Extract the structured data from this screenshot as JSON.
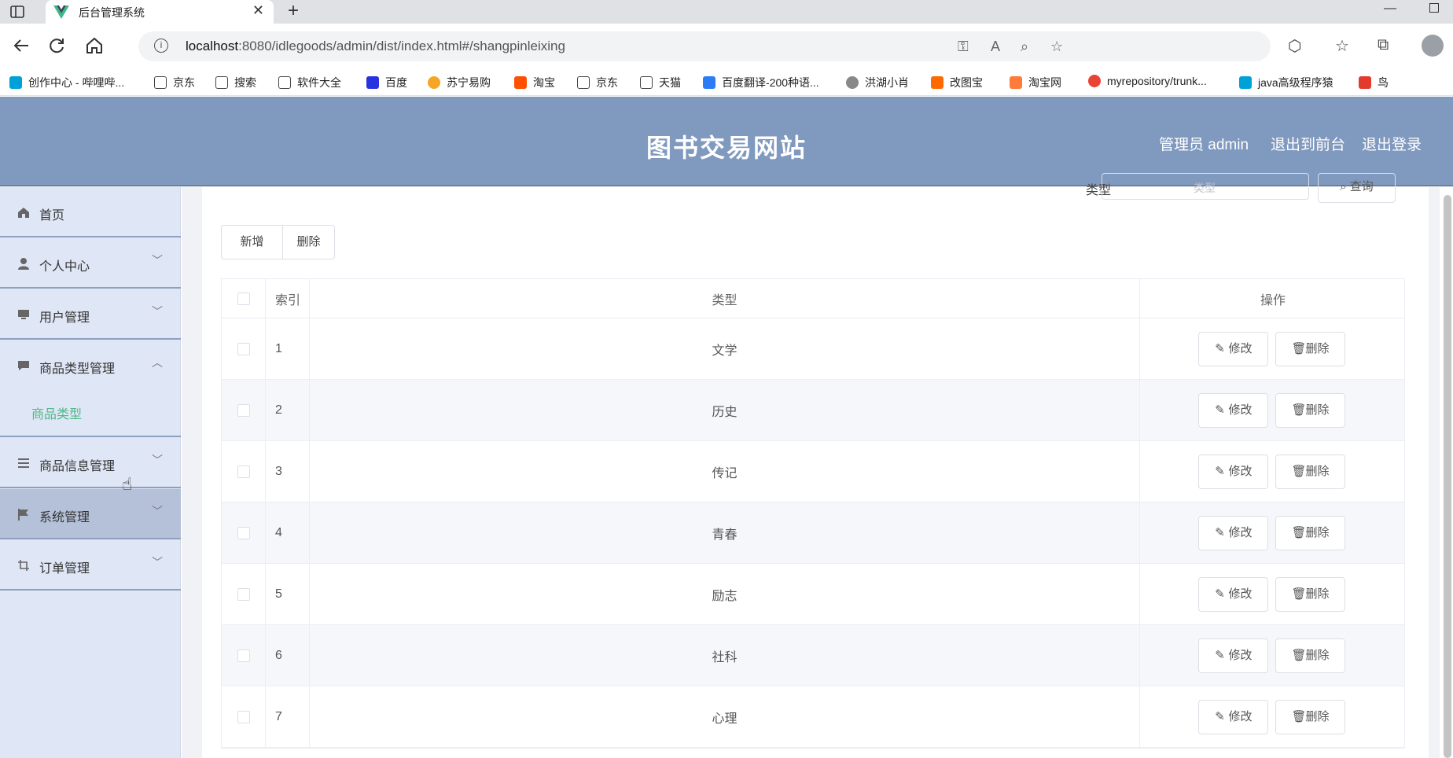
{
  "browser": {
    "tab_title": "后台管理系统",
    "url_host": "localhost",
    "url_rest": ":8080/idlegoods/admin/dist/index.html#/shangpinleixing",
    "bookmarks": [
      "创作中心 - 哔哩哔...",
      "京东",
      "搜索",
      "软件大全",
      "百度",
      "苏宁易购",
      "淘宝",
      "京东",
      "天猫",
      "百度翻译-200种语...",
      "洪湖小肖",
      "改图宝",
      "淘宝网",
      "myrepository/trunk...",
      "java高级程序猿",
      "鸟"
    ]
  },
  "header": {
    "site_title": "图书交易网站",
    "admin_label": "管理员 admin",
    "to_front": "退出到前台",
    "logout": "退出登录"
  },
  "sidebar": {
    "items": [
      {
        "label": "首页",
        "icon": "home-icon"
      },
      {
        "label": "个人中心",
        "icon": "user-icon"
      },
      {
        "label": "用户管理",
        "icon": "monitor-icon"
      },
      {
        "label": "商品类型管理",
        "icon": "chat-icon"
      },
      {
        "label": "商品信息管理",
        "icon": "list-icon"
      },
      {
        "label": "系统管理",
        "icon": "flag-icon"
      },
      {
        "label": "订单管理",
        "icon": "crop-icon"
      }
    ],
    "submenu_active": "商品类型"
  },
  "search": {
    "label": "类型",
    "placeholder": "类型",
    "button": "查询"
  },
  "toolbar": {
    "add_label": "新增",
    "delete_label": "删除"
  },
  "table": {
    "columns": [
      "索引",
      "类型",
      "操作"
    ],
    "rows": [
      {
        "index": "1",
        "type": "文学"
      },
      {
        "index": "2",
        "type": "历史"
      },
      {
        "index": "3",
        "type": "传记"
      },
      {
        "index": "4",
        "type": "青春"
      },
      {
        "index": "5",
        "type": "励志"
      },
      {
        "index": "6",
        "type": "社科"
      },
      {
        "index": "7",
        "type": "心理"
      }
    ],
    "edit_label": "修改",
    "delete_label": "删除"
  }
}
